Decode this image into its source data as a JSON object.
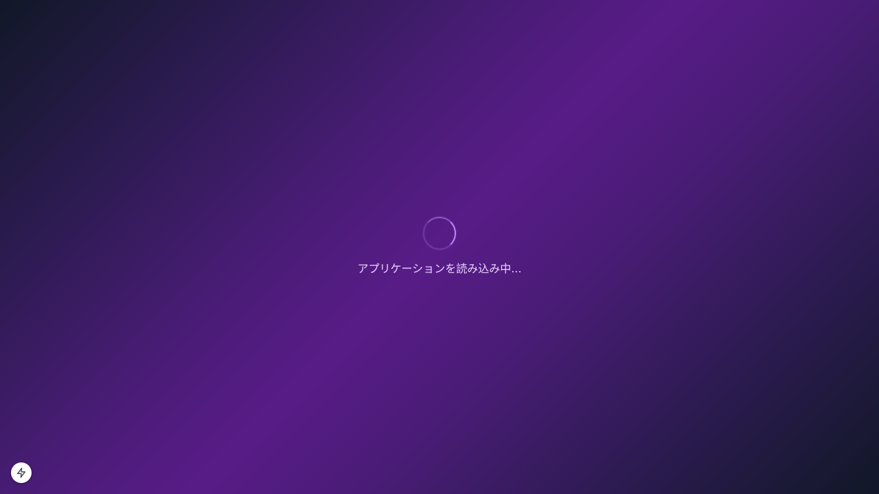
{
  "loading": {
    "text": "アプリケーションを読み込み中...",
    "spinner_icon": "loading-spinner-icon",
    "accent_color": "#c084fc"
  },
  "dev_badge": {
    "icon": "lightning-bolt-icon"
  },
  "background": {
    "colors": [
      "#111827",
      "#581c87",
      "#111827"
    ]
  }
}
